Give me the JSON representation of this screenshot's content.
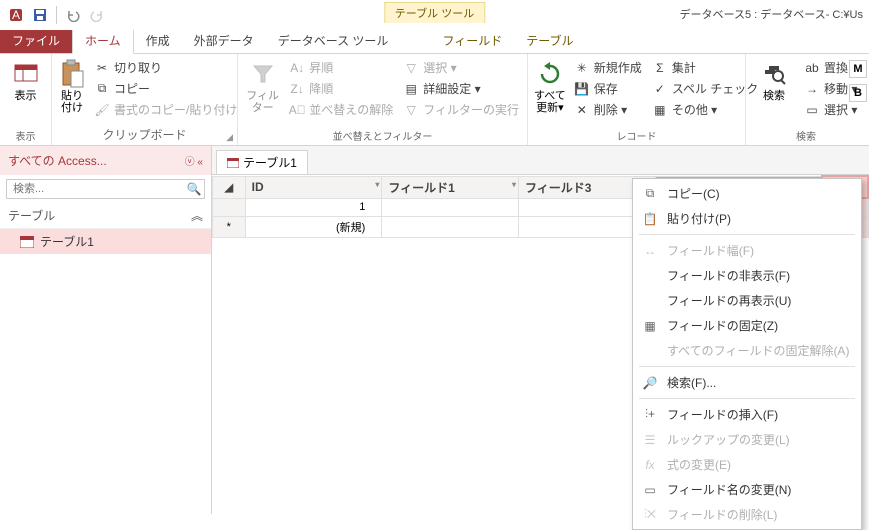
{
  "title_right": "データベース5 : データベース- C:¥Us",
  "tool_context": "テーブル ツール",
  "tabs": {
    "file": "ファイル",
    "home": "ホーム",
    "create": "作成",
    "external": "外部データ",
    "dbtools": "データベース ツール",
    "fields": "フィールド",
    "table": "テーブル"
  },
  "ribbon": {
    "view": {
      "big": "表示",
      "label": "表示"
    },
    "clipboard": {
      "big": "貼り付け",
      "cut": "切り取り",
      "copy": "コピー",
      "fmt": "書式のコピー/貼り付け",
      "label": "クリップボード"
    },
    "sortfilter": {
      "big": "フィルター",
      "asc": "昇順",
      "desc": "降順",
      "clear": "並べ替えの解除",
      "sel": "選択 ▾",
      "adv": "詳細設定 ▾",
      "toggle": "フィルターの実行",
      "label": "並べ替えとフィルター"
    },
    "records": {
      "big": "すべて\n更新▾",
      "new": "新規作成",
      "save": "保存",
      "delete": "削除 ▾",
      "totals": "集計",
      "spell": "スペル チェック",
      "more": "その他 ▾",
      "label": "レコード"
    },
    "find": {
      "big": "検索",
      "replace": "置換",
      "goto": "移動 ▾",
      "select": "選択 ▾",
      "label": "検索"
    }
  },
  "rightedge": {
    "m": "M",
    "b": "B"
  },
  "nav": {
    "header": "すべての Access...",
    "search_ph": "検索...",
    "cat": "テーブル",
    "item1": "テーブル1"
  },
  "doc_tab": "テーブル1",
  "grid": {
    "cols": [
      "ID",
      "フィールド1",
      "フィールド3"
    ],
    "row1_id": "1",
    "newrow": "(新規)",
    "newrow_marker": "*"
  },
  "menu": {
    "copy": "コピー(C)",
    "paste": "貼り付け(P)",
    "fieldwidth": "フィールド幅(F)",
    "hide": "フィールドの非表示(F)",
    "unhide": "フィールドの再表示(U)",
    "freeze": "フィールドの固定(Z)",
    "unfreeze": "すべてのフィールドの固定解除(A)",
    "find": "検索(F)...",
    "insert": "フィールドの挿入(F)",
    "lookup": "ルックアップの変更(L)",
    "expr": "式の変更(E)",
    "rename": "フィールド名の変更(N)",
    "delete": "フィールドの削除(L)"
  },
  "chart_data": {
    "type": "table",
    "columns": [
      "ID",
      "フィールド1",
      "フィールド3"
    ],
    "rows": [
      {
        "ID": 1,
        "フィールド1": "",
        "フィールド3": ""
      }
    ]
  }
}
